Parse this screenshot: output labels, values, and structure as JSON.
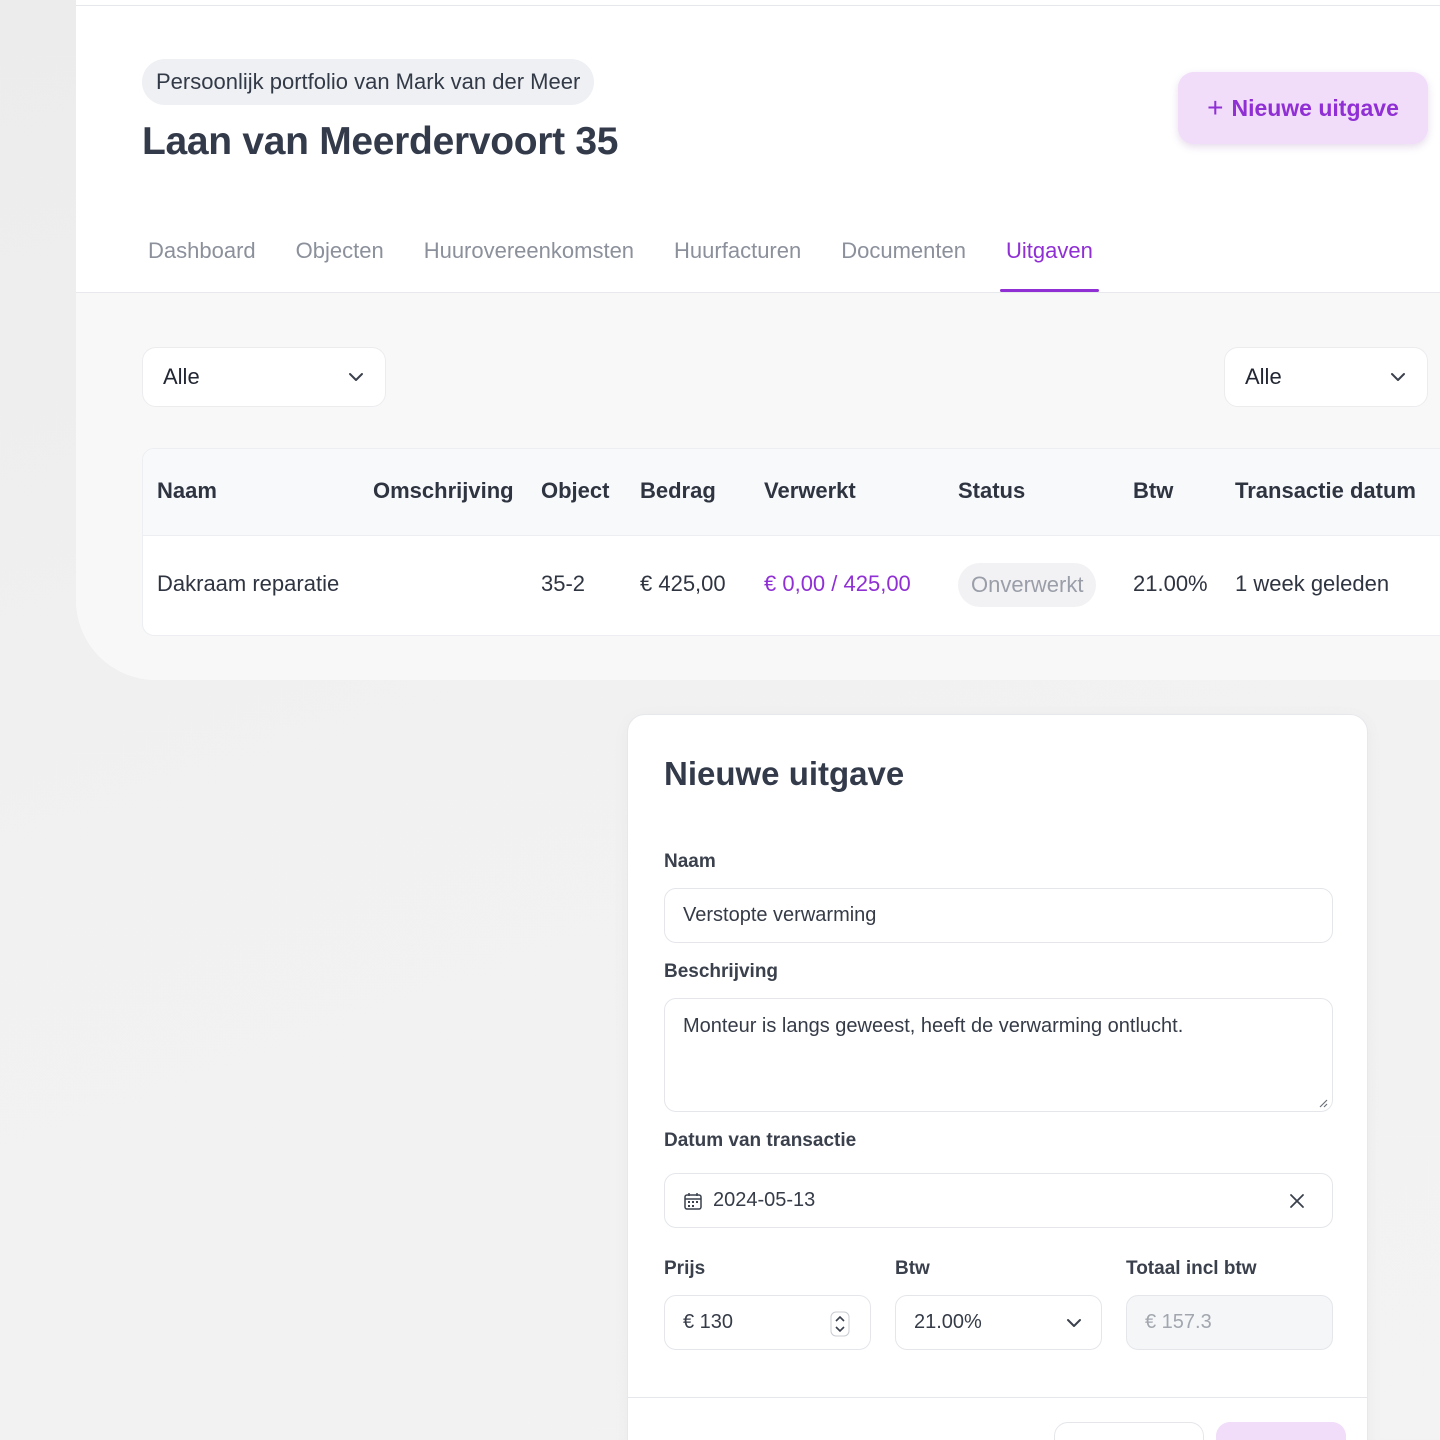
{
  "header": {
    "portfolio_label": "Persoonlijk portfolio van Mark van der Meer",
    "title": "Laan van Meerdervoort 35",
    "new_button": "Nieuwe uitgave"
  },
  "tabs": [
    {
      "label": "Dashboard",
      "active": false
    },
    {
      "label": "Objecten",
      "active": false
    },
    {
      "label": "Huurovereenkomsten",
      "active": false
    },
    {
      "label": "Huurfacturen",
      "active": false
    },
    {
      "label": "Documenten",
      "active": false
    },
    {
      "label": "Uitgaven",
      "active": true
    }
  ],
  "filters": {
    "left": "Alle",
    "right": "Alle"
  },
  "table": {
    "columns": [
      "Naam",
      "Omschrijving",
      "Object",
      "Bedrag",
      "Verwerkt",
      "Status",
      "Btw",
      "Transactie datum"
    ],
    "rows": [
      {
        "naam": "Dakraam reparatie",
        "omschrijving": "",
        "object": "35-2",
        "bedrag": "€ 425,00",
        "verwerkt": "€ 0,00 / 425,00",
        "status": "Onverwerkt",
        "btw": "21.00%",
        "datum": "1 week geleden"
      }
    ]
  },
  "modal": {
    "title": "Nieuwe uitgave",
    "name_label": "Naam",
    "name_value": "Verstopte verwarming",
    "description_label": "Beschrijving",
    "description_value": "Monteur is langs geweest, heeft de verwarming ontlucht.",
    "date_label": "Datum van transactie",
    "date_value": "2024-05-13",
    "price_label": "Prijs",
    "price_value": "€ 130",
    "vat_label": "Btw",
    "vat_value": "21.00%",
    "total_label": "Totaal incl btw",
    "total_value": "€ 157.3"
  },
  "colors": {
    "accent": "#8f2fd4",
    "accent_light": "#f1dcfa"
  }
}
